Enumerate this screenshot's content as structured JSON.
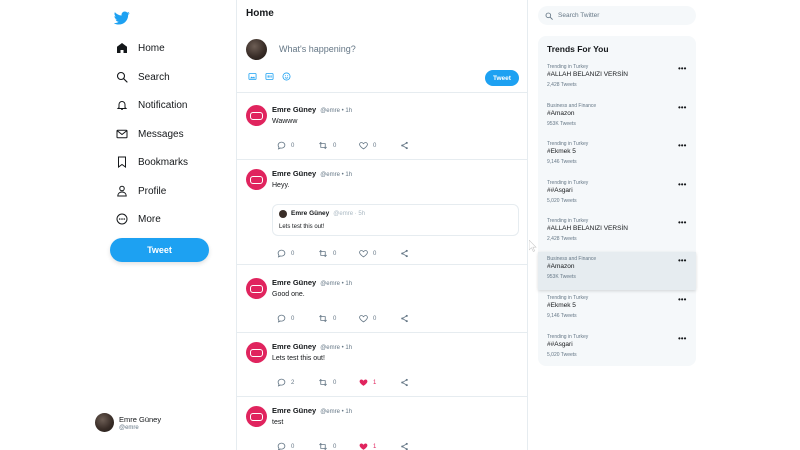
{
  "colors": {
    "accent": "#1da1f2",
    "like": "#e0245e",
    "text": "#14171a",
    "muted": "#657786",
    "panel": "#f5f8fa"
  },
  "nav": [
    {
      "label": "Home",
      "icon": "home-icon"
    },
    {
      "label": "Search",
      "icon": "search-icon"
    },
    {
      "label": "Notification",
      "icon": "bell-icon"
    },
    {
      "label": "Messages",
      "icon": "envelope-icon"
    },
    {
      "label": "Bookmarks",
      "icon": "bookmark-icon"
    },
    {
      "label": "Profile",
      "icon": "person-icon"
    },
    {
      "label": "More",
      "icon": "more-circle-icon"
    }
  ],
  "sidebar": {
    "tweet_label": "Tweet"
  },
  "user": {
    "name": "Emre Güney",
    "handle": "@emre"
  },
  "main": {
    "title": "Home"
  },
  "composer": {
    "placeholder": "What's happening?",
    "button": "Tweet"
  },
  "tweets": [
    {
      "name": "Emre Güney",
      "meta": "@emre • 1h",
      "text": "Wawww",
      "replies": "0",
      "retweets": "0",
      "likes": "0",
      "liked": false
    },
    {
      "name": "Emre Güney",
      "meta": "@emre • 1h",
      "text": "Heyy.",
      "replies": "0",
      "retweets": "0",
      "likes": "0",
      "liked": false,
      "quote": {
        "name": "Emre Güney",
        "meta": "@emre · 5h",
        "text": "Lets test this out!"
      }
    },
    {
      "name": "Emre Güney",
      "meta": "@emre • 1h",
      "text": "Good one.",
      "replies": "0",
      "retweets": "0",
      "likes": "0",
      "liked": false
    },
    {
      "name": "Emre Güney",
      "meta": "@emre • 1h",
      "text": "Lets test this out!",
      "replies": "2",
      "retweets": "0",
      "likes": "1",
      "liked": true
    },
    {
      "name": "Emre Güney",
      "meta": "@emre • 1h",
      "text": "test",
      "replies": "0",
      "retweets": "0",
      "likes": "1",
      "liked": true
    }
  ],
  "search": {
    "placeholder": "Search Twitter"
  },
  "trends_title": "Trends For You",
  "trends": [
    {
      "category": "Trending in Turkey",
      "tag": "#ALLAH BELANIZI VERSİN",
      "count": "2,428 Tweets"
    },
    {
      "category": "Business and Finance",
      "tag": "#Amazon",
      "count": "953K Tweets"
    },
    {
      "category": "Trending in Turkey",
      "tag": "#Ekmek 5",
      "count": "9,146 Tweets"
    },
    {
      "category": "Trending in Turkey",
      "tag": "##Asgari",
      "count": "5,020 Tweets"
    },
    {
      "category": "Trending in Turkey",
      "tag": "#ALLAH BELANIZI VERSİN",
      "count": "2,428 Tweets"
    },
    {
      "category": "Business and Finance",
      "tag": "#Amazon",
      "count": "953K Tweets"
    },
    {
      "category": "Trending in Turkey",
      "tag": "#Ekmek 5",
      "count": "9,146 Tweets"
    },
    {
      "category": "Trending in Turkey",
      "tag": "##Asgari",
      "count": "5,020 Tweets"
    }
  ]
}
